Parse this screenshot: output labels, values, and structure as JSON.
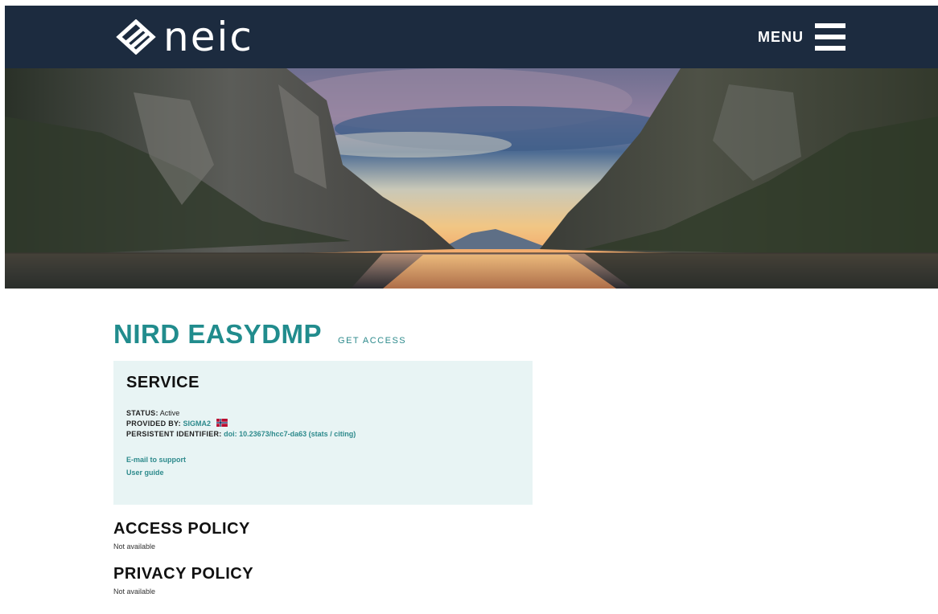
{
  "header": {
    "logo_text": "neic",
    "menu_label": "MENU"
  },
  "hero": {
    "alt": "fjord landscape banner"
  },
  "main": {
    "title": "NIRD EASYDMP",
    "get_access_label": "GET ACCESS",
    "service": {
      "heading": "SERVICE",
      "status_label": "STATUS:",
      "status_value": "Active",
      "provided_by_label": "PROVIDED BY:",
      "provided_by_value": "SIGMA2",
      "identifier_label": "PERSISTENT IDENTIFIER:",
      "identifier_value": "doi: 10.23673/hcc7-da63 (stats / citing)",
      "support_link": "E-mail to support",
      "guide_link": "User guide"
    },
    "access_policy": {
      "heading": "ACCESS POLICY",
      "text": "Not available"
    },
    "privacy_policy": {
      "heading": "PRIVACY POLICY",
      "text": "Not available"
    }
  },
  "colors": {
    "header_bg": "#1c2b3f",
    "accent": "#218c8d",
    "service_bg": "#e8f4f4"
  },
  "icons": {
    "logo": "neic-logo-icon",
    "menu": "hamburger-menu-icon",
    "flag": "norway-flag-icon"
  }
}
